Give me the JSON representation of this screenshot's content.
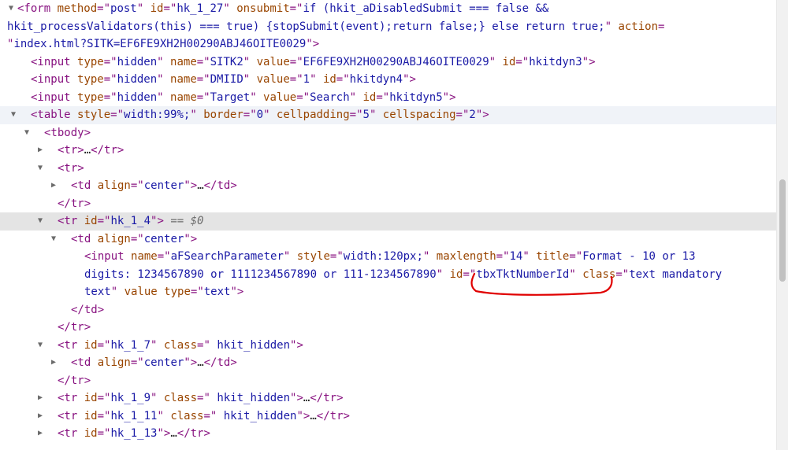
{
  "lines": [
    {
      "indent": 0,
      "toggle": "open",
      "parts": [
        {
          "c": "t",
          "v": "<form "
        },
        {
          "c": "an",
          "v": "method"
        },
        {
          "c": "eq",
          "v": "=\""
        },
        {
          "c": "av",
          "v": "post"
        },
        {
          "c": "eq",
          "v": "\" "
        },
        {
          "c": "an",
          "v": "id"
        },
        {
          "c": "eq",
          "v": "=\""
        },
        {
          "c": "av",
          "v": "hk_1_27"
        },
        {
          "c": "eq",
          "v": "\" "
        },
        {
          "c": "an",
          "v": "onsubmit"
        },
        {
          "c": "eq",
          "v": "=\""
        },
        {
          "c": "av",
          "v": "if (hkit_aDisabledSubmit === false &&"
        }
      ]
    },
    {
      "indent": 0,
      "cont": true,
      "parts": [
        {
          "c": "av",
          "v": "hkit_processValidators(this) === true) {stopSubmit(event);return false;} else return true;"
        },
        {
          "c": "eq",
          "v": "\" "
        },
        {
          "c": "an",
          "v": "action"
        },
        {
          "c": "eq",
          "v": "="
        }
      ]
    },
    {
      "indent": 0,
      "cont": true,
      "parts": [
        {
          "c": "eq",
          "v": "\""
        },
        {
          "c": "av",
          "v": "index.html?SITK=EF6FE9XH2H00290ABJ46OITE0029"
        },
        {
          "c": "eq",
          "v": "\""
        },
        {
          "c": "t",
          "v": ">"
        }
      ]
    },
    {
      "indent": 1,
      "parts": [
        {
          "c": "t",
          "v": "<input "
        },
        {
          "c": "an",
          "v": "type"
        },
        {
          "c": "eq",
          "v": "=\""
        },
        {
          "c": "av",
          "v": "hidden"
        },
        {
          "c": "eq",
          "v": "\" "
        },
        {
          "c": "an",
          "v": "name"
        },
        {
          "c": "eq",
          "v": "=\""
        },
        {
          "c": "av",
          "v": "SITK2"
        },
        {
          "c": "eq",
          "v": "\" "
        },
        {
          "c": "an",
          "v": "value"
        },
        {
          "c": "eq",
          "v": "=\""
        },
        {
          "c": "av",
          "v": "EF6FE9XH2H00290ABJ46OITE0029"
        },
        {
          "c": "eq",
          "v": "\" "
        },
        {
          "c": "an",
          "v": "id"
        },
        {
          "c": "eq",
          "v": "=\""
        },
        {
          "c": "av",
          "v": "hkitdyn3"
        },
        {
          "c": "eq",
          "v": "\""
        },
        {
          "c": "t",
          "v": ">"
        }
      ]
    },
    {
      "indent": 1,
      "parts": [
        {
          "c": "t",
          "v": "<input "
        },
        {
          "c": "an",
          "v": "type"
        },
        {
          "c": "eq",
          "v": "=\""
        },
        {
          "c": "av",
          "v": "hidden"
        },
        {
          "c": "eq",
          "v": "\" "
        },
        {
          "c": "an",
          "v": "name"
        },
        {
          "c": "eq",
          "v": "=\""
        },
        {
          "c": "av",
          "v": "DMIID"
        },
        {
          "c": "eq",
          "v": "\" "
        },
        {
          "c": "an",
          "v": "value"
        },
        {
          "c": "eq",
          "v": "=\""
        },
        {
          "c": "av",
          "v": "1"
        },
        {
          "c": "eq",
          "v": "\" "
        },
        {
          "c": "an",
          "v": "id"
        },
        {
          "c": "eq",
          "v": "=\""
        },
        {
          "c": "av",
          "v": "hkitdyn4"
        },
        {
          "c": "eq",
          "v": "\""
        },
        {
          "c": "t",
          "v": ">"
        }
      ]
    },
    {
      "indent": 1,
      "parts": [
        {
          "c": "t",
          "v": "<input "
        },
        {
          "c": "an",
          "v": "type"
        },
        {
          "c": "eq",
          "v": "=\""
        },
        {
          "c": "av",
          "v": "hidden"
        },
        {
          "c": "eq",
          "v": "\" "
        },
        {
          "c": "an",
          "v": "name"
        },
        {
          "c": "eq",
          "v": "=\""
        },
        {
          "c": "av",
          "v": "Target"
        },
        {
          "c": "eq",
          "v": "\" "
        },
        {
          "c": "an",
          "v": "value"
        },
        {
          "c": "eq",
          "v": "=\""
        },
        {
          "c": "av",
          "v": "Search"
        },
        {
          "c": "eq",
          "v": "\" "
        },
        {
          "c": "an",
          "v": "id"
        },
        {
          "c": "eq",
          "v": "=\""
        },
        {
          "c": "av",
          "v": "hkitdyn5"
        },
        {
          "c": "eq",
          "v": "\""
        },
        {
          "c": "t",
          "v": ">"
        }
      ]
    },
    {
      "indent": 1,
      "toggle": "open",
      "hover": true,
      "parts": [
        {
          "c": "t",
          "v": "<table "
        },
        {
          "c": "an",
          "v": "style"
        },
        {
          "c": "eq",
          "v": "=\""
        },
        {
          "c": "av",
          "v": "width:99%;"
        },
        {
          "c": "eq",
          "v": "\" "
        },
        {
          "c": "an",
          "v": "border"
        },
        {
          "c": "eq",
          "v": "=\""
        },
        {
          "c": "av",
          "v": "0"
        },
        {
          "c": "eq",
          "v": "\" "
        },
        {
          "c": "an",
          "v": "cellpadding"
        },
        {
          "c": "eq",
          "v": "=\""
        },
        {
          "c": "av",
          "v": "5"
        },
        {
          "c": "eq",
          "v": "\" "
        },
        {
          "c": "an",
          "v": "cellspacing"
        },
        {
          "c": "eq",
          "v": "=\""
        },
        {
          "c": "av",
          "v": "2"
        },
        {
          "c": "eq",
          "v": "\""
        },
        {
          "c": "t",
          "v": ">"
        }
      ]
    },
    {
      "indent": 2,
      "toggle": "open",
      "parts": [
        {
          "c": "t",
          "v": "<tbody>"
        }
      ]
    },
    {
      "indent": 3,
      "toggle": "closed",
      "parts": [
        {
          "c": "t",
          "v": "<tr>"
        },
        {
          "c": "txt",
          "v": "…"
        },
        {
          "c": "t",
          "v": "</tr>"
        }
      ]
    },
    {
      "indent": 3,
      "toggle": "open",
      "parts": [
        {
          "c": "t",
          "v": "<tr>"
        }
      ]
    },
    {
      "indent": 4,
      "toggle": "closed",
      "parts": [
        {
          "c": "t",
          "v": "<td "
        },
        {
          "c": "an",
          "v": "align"
        },
        {
          "c": "eq",
          "v": "=\""
        },
        {
          "c": "av",
          "v": "center"
        },
        {
          "c": "eq",
          "v": "\""
        },
        {
          "c": "t",
          "v": ">"
        },
        {
          "c": "txt",
          "v": "…"
        },
        {
          "c": "t",
          "v": "</td>"
        }
      ]
    },
    {
      "indent": 3,
      "parts": [
        {
          "c": "t",
          "v": "</tr>"
        }
      ]
    },
    {
      "indent": 3,
      "toggle": "open",
      "selected": true,
      "parts": [
        {
          "c": "t",
          "v": "<tr "
        },
        {
          "c": "an",
          "v": "id"
        },
        {
          "c": "eq",
          "v": "=\""
        },
        {
          "c": "av",
          "v": "hk_1_4"
        },
        {
          "c": "eq",
          "v": "\""
        },
        {
          "c": "t",
          "v": ">"
        },
        {
          "c": "cm",
          "v": " == $0"
        }
      ]
    },
    {
      "indent": 4,
      "toggle": "open",
      "parts": [
        {
          "c": "t",
          "v": "<td "
        },
        {
          "c": "an",
          "v": "align"
        },
        {
          "c": "eq",
          "v": "=\""
        },
        {
          "c": "av",
          "v": "center"
        },
        {
          "c": "eq",
          "v": "\""
        },
        {
          "c": "t",
          "v": ">"
        }
      ]
    },
    {
      "indent": 5,
      "parts": [
        {
          "c": "t",
          "v": "<input "
        },
        {
          "c": "an",
          "v": "name"
        },
        {
          "c": "eq",
          "v": "=\""
        },
        {
          "c": "av",
          "v": "aFSearchParameter"
        },
        {
          "c": "eq",
          "v": "\" "
        },
        {
          "c": "an",
          "v": "style"
        },
        {
          "c": "eq",
          "v": "=\""
        },
        {
          "c": "av",
          "v": "width:120px;"
        },
        {
          "c": "eq",
          "v": "\" "
        },
        {
          "c": "an",
          "v": "maxlength"
        },
        {
          "c": "eq",
          "v": "=\""
        },
        {
          "c": "av",
          "v": "14"
        },
        {
          "c": "eq",
          "v": "\" "
        },
        {
          "c": "an",
          "v": "title"
        },
        {
          "c": "eq",
          "v": "=\""
        },
        {
          "c": "av",
          "v": "Format - 10 or 13"
        }
      ]
    },
    {
      "indent": 5,
      "cont": true,
      "parts": [
        {
          "c": "av",
          "v": "digits: 1234567890 or 1111234567890 or 111-1234567890"
        },
        {
          "c": "eq",
          "v": "\" "
        },
        {
          "c": "an",
          "v": "id"
        },
        {
          "c": "eq",
          "v": "=\""
        },
        {
          "c": "av",
          "v": "tbxTktNumberId"
        },
        {
          "c": "eq",
          "v": "\" "
        },
        {
          "c": "an",
          "v": "class"
        },
        {
          "c": "eq",
          "v": "=\""
        },
        {
          "c": "av",
          "v": "text mandatory"
        }
      ]
    },
    {
      "indent": 5,
      "cont": true,
      "parts": [
        {
          "c": "av",
          "v": "text"
        },
        {
          "c": "eq",
          "v": "\" "
        },
        {
          "c": "an",
          "v": "value"
        },
        {
          "c": "eq",
          "v": " "
        },
        {
          "c": "an",
          "v": "type"
        },
        {
          "c": "eq",
          "v": "=\""
        },
        {
          "c": "av",
          "v": "text"
        },
        {
          "c": "eq",
          "v": "\""
        },
        {
          "c": "t",
          "v": ">"
        }
      ]
    },
    {
      "indent": 4,
      "parts": [
        {
          "c": "t",
          "v": "</td>"
        }
      ]
    },
    {
      "indent": 3,
      "parts": [
        {
          "c": "t",
          "v": "</tr>"
        }
      ]
    },
    {
      "indent": 3,
      "toggle": "open",
      "parts": [
        {
          "c": "t",
          "v": "<tr "
        },
        {
          "c": "an",
          "v": "id"
        },
        {
          "c": "eq",
          "v": "=\""
        },
        {
          "c": "av",
          "v": "hk_1_7"
        },
        {
          "c": "eq",
          "v": "\" "
        },
        {
          "c": "an",
          "v": "class"
        },
        {
          "c": "eq",
          "v": "=\""
        },
        {
          "c": "av",
          "v": " hkit_hidden"
        },
        {
          "c": "eq",
          "v": "\""
        },
        {
          "c": "t",
          "v": ">"
        }
      ]
    },
    {
      "indent": 4,
      "toggle": "closed",
      "parts": [
        {
          "c": "t",
          "v": "<td "
        },
        {
          "c": "an",
          "v": "align"
        },
        {
          "c": "eq",
          "v": "=\""
        },
        {
          "c": "av",
          "v": "center"
        },
        {
          "c": "eq",
          "v": "\""
        },
        {
          "c": "t",
          "v": ">"
        },
        {
          "c": "txt",
          "v": "…"
        },
        {
          "c": "t",
          "v": "</td>"
        }
      ]
    },
    {
      "indent": 3,
      "parts": [
        {
          "c": "t",
          "v": "</tr>"
        }
      ]
    },
    {
      "indent": 3,
      "toggle": "closed",
      "parts": [
        {
          "c": "t",
          "v": "<tr "
        },
        {
          "c": "an",
          "v": "id"
        },
        {
          "c": "eq",
          "v": "=\""
        },
        {
          "c": "av",
          "v": "hk_1_9"
        },
        {
          "c": "eq",
          "v": "\" "
        },
        {
          "c": "an",
          "v": "class"
        },
        {
          "c": "eq",
          "v": "=\""
        },
        {
          "c": "av",
          "v": " hkit_hidden"
        },
        {
          "c": "eq",
          "v": "\""
        },
        {
          "c": "t",
          "v": ">"
        },
        {
          "c": "txt",
          "v": "…"
        },
        {
          "c": "t",
          "v": "</tr>"
        }
      ]
    },
    {
      "indent": 3,
      "toggle": "closed",
      "parts": [
        {
          "c": "t",
          "v": "<tr "
        },
        {
          "c": "an",
          "v": "id"
        },
        {
          "c": "eq",
          "v": "=\""
        },
        {
          "c": "av",
          "v": "hk_1_11"
        },
        {
          "c": "eq",
          "v": "\" "
        },
        {
          "c": "an",
          "v": "class"
        },
        {
          "c": "eq",
          "v": "=\""
        },
        {
          "c": "av",
          "v": " hkit_hidden"
        },
        {
          "c": "eq",
          "v": "\""
        },
        {
          "c": "t",
          "v": ">"
        },
        {
          "c": "txt",
          "v": "…"
        },
        {
          "c": "t",
          "v": "</tr>"
        }
      ]
    },
    {
      "indent": 3,
      "toggle": "closed",
      "parts": [
        {
          "c": "t",
          "v": "<tr "
        },
        {
          "c": "an",
          "v": "id"
        },
        {
          "c": "eq",
          "v": "=\""
        },
        {
          "c": "av",
          "v": "hk_1_13"
        },
        {
          "c": "eq",
          "v": "\""
        },
        {
          "c": "t",
          "v": ">"
        },
        {
          "c": "txt",
          "v": "…"
        },
        {
          "c": "t",
          "v": "</tr>"
        }
      ]
    }
  ],
  "colors": {
    "tag": "#881280",
    "attr_name": "#994500",
    "attr_value": "#1a1aa6",
    "annotation": "#e00000",
    "selected_row": "#e4e4e4"
  },
  "annotation_icon": "red-hand-drawn-underline"
}
